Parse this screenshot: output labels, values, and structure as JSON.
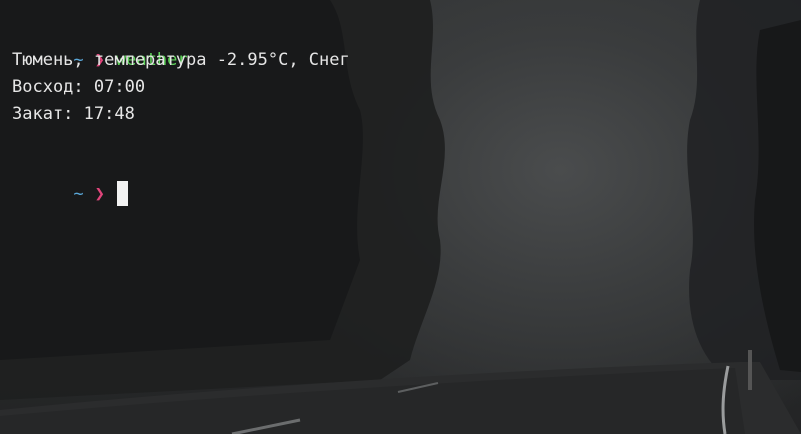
{
  "prompt": {
    "tilde": "~",
    "chevron": "❯",
    "colors": {
      "tilde": "#5aa7d8",
      "chevron": "#e0457b",
      "command": "#5fd35a"
    }
  },
  "session": {
    "command": "weather",
    "output": [
      "Тюмень, температура -2.95°C, Снег",
      "Восход: 07:00",
      "Закат: 17:48"
    ]
  },
  "background": {
    "icon": "foggy-forest-road-wallpaper"
  }
}
